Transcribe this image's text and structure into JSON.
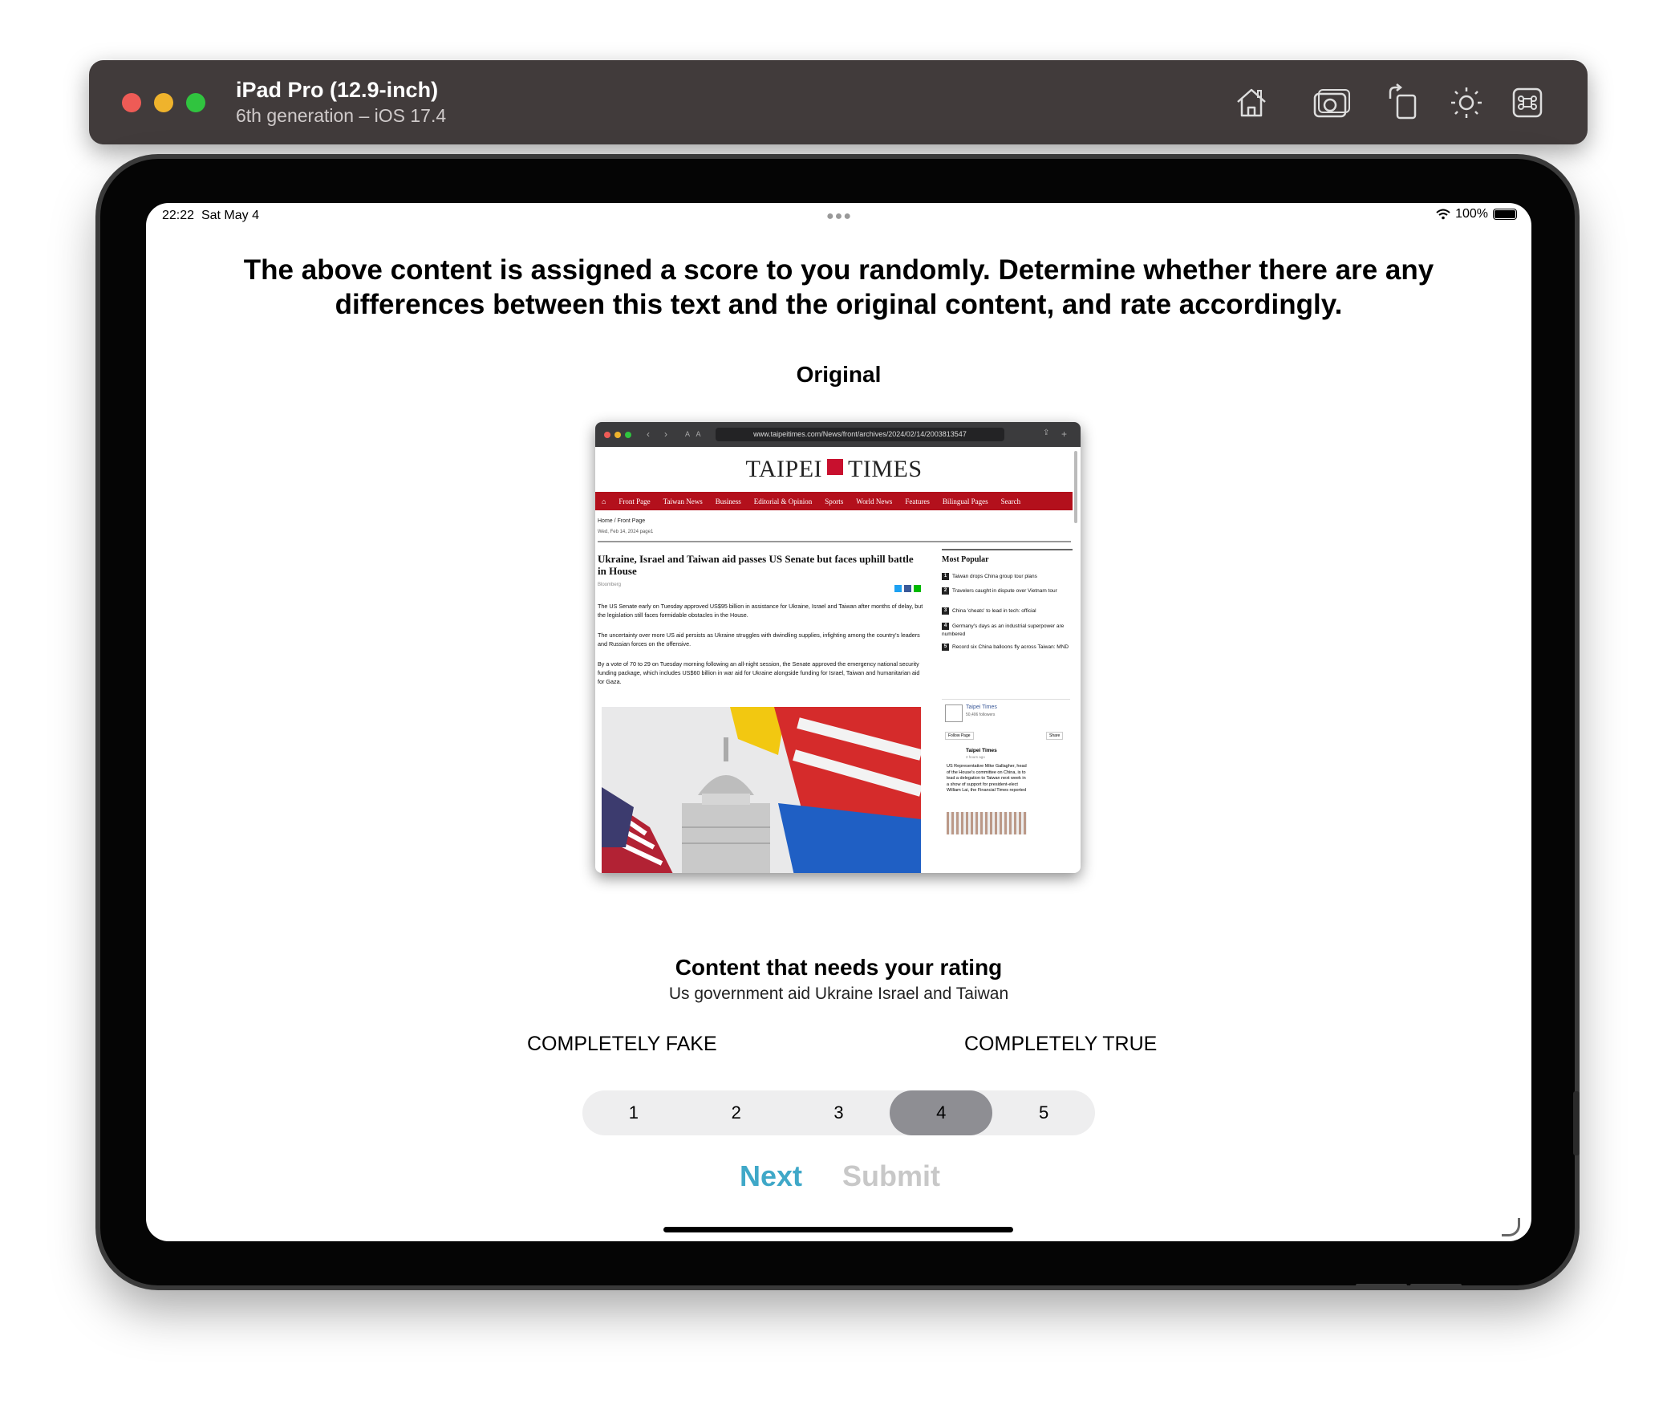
{
  "simulator": {
    "device_name": "iPad Pro (12.9-inch)",
    "device_detail": "6th generation – iOS 17.4",
    "toolbar_icons": [
      "home-icon",
      "screenshot-icon",
      "rotate-icon",
      "appearance-icon",
      "command-icon"
    ]
  },
  "status_bar": {
    "time": "22:22",
    "date": "Sat May 4",
    "battery": "100%"
  },
  "page": {
    "instructions": "The above content is assigned a score to you randomly. Determine whether there are any differences between this text and the original content, and rate accordingly.",
    "original_label": "Original",
    "rating_title": "Content that needs your rating",
    "rating_content": "Us government aid Ukraine Israel and Taiwan",
    "scale_low_label": "COMPLETELY FAKE",
    "scale_high_label": "COMPLETELY TRUE",
    "rating_options": [
      "1",
      "2",
      "3",
      "4",
      "5"
    ],
    "selected_rating": "4",
    "next_label": "Next",
    "submit_label": "Submit"
  },
  "embedded_screenshot": {
    "url": "www.taipeitimes.com/News/front/archives/2024/02/14/2003813547",
    "site_name_left": "TAIPEI",
    "site_name_right": "TIMES",
    "nav_items": [
      "Front Page",
      "Taiwan News",
      "Business",
      "Editorial & Opinion",
      "Sports",
      "World News",
      "Features",
      "Bilingual Pages",
      "Search"
    ],
    "breadcrumb": "Home / Front Page",
    "dateline": "Wed, Feb 14, 2024 page1",
    "headline": "Ukraine, Israel and Taiwan aid passes US Senate but faces uphill battle in House",
    "byline": "Bloomberg",
    "paragraphs": [
      "The US Senate early on Tuesday approved US$95 billion in assistance for Ukraine, Israel and Taiwan after months of delay, but the legislation still faces formidable obstacles in the House.",
      "The uncertainty over more US aid persists as Ukraine struggles with dwindling supplies, infighting among the country's leaders and Russian forces on the offensive.",
      "By a vote of 70 to 29 on Tuesday morning following an all-night session, the Senate approved the emergency national security funding package, which includes US$60 billion in war aid for Ukraine alongside funding for Israel, Taiwan and humanitarian aid for Gaza."
    ],
    "most_popular_title": "Most Popular",
    "most_popular": [
      {
        "rank": "1",
        "text": "Taiwan drops China group tour plans"
      },
      {
        "rank": "2",
        "text": "Travelers caught in dispute over Vietnam tour"
      },
      {
        "rank": "3",
        "text": "China 'cheats' to lead in tech: official"
      },
      {
        "rank": "4",
        "text": "Germany's days as an industrial superpower are numbered"
      },
      {
        "rank": "5",
        "text": "Record six China balloons fly across Taiwan: MND"
      }
    ],
    "fb_page_name": "Taipei Times",
    "fb_followers": "50,406 followers",
    "fb_follow": "Follow Page",
    "fb_share": "Share",
    "fb_post_author": "Taipei Times",
    "fb_post_time": "2 hours ago",
    "fb_post_text": "US Representative Mike Gallagher, head of the House's committee on China, is to lead a delegation to Taiwan next week in a show of support for president-elect William Lai, the Financial Times reported"
  }
}
